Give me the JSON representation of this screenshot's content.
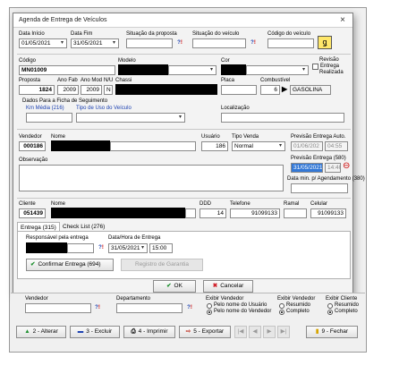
{
  "window": {
    "title": "Agenda de Entrega de Veículos",
    "close": "×"
  },
  "filter": {
    "data_inicio_label": "Data Início",
    "data_inicio": "01/05/2021",
    "data_fim_label": "Data Fim",
    "data_fim": "31/05/2021",
    "situacao_proposta_label": "Situação da proposta",
    "situacao_veiculo_label": "Situação do veículo",
    "codigo_veiculo_label": "Código do veículo",
    "lookup": "?",
    "lookup_mark": "!"
  },
  "vehicle": {
    "codigo_label": "Código",
    "codigo": "MN01009",
    "modelo_label": "Modelo",
    "cor_label": "Cor",
    "revisao_label": "Revisão",
    "entrega_label": "Entrega",
    "realizada_label": "Realizada",
    "proposta_label": "Proposta",
    "proposta": "1824",
    "ano_fab_label": "Ano Fab",
    "ano_fab": "2009",
    "ano_mod_label": "Ano Mod",
    "ano_mod": "2009",
    "nu_label": "N/U",
    "nu": "N",
    "chassi_label": "Chassi",
    "placa_label": "Placa",
    "combustivel_label": "Combustível",
    "combustivel_code": "6",
    "combustivel": "GASOLINA"
  },
  "followup": {
    "group_label": "Dados Para a Ficha de Seguimento",
    "km_label": "Km Média (216)",
    "tipo_uso_label": "Tipo de Uso do Veículo",
    "localizacao_label": "Localização"
  },
  "seller": {
    "vendedor_label": "Vendedor",
    "vendedor": "000186",
    "nome_label": "Nome",
    "usuario_label": "Usuário",
    "usuario": "186",
    "tipo_venda_label": "Tipo Venda",
    "tipo_venda": "Normal",
    "prev_auto_label": "Previsão Entrega Auto.",
    "prev_auto_date": "01/06/202",
    "prev_auto_time": "04:55",
    "obs_label": "Observação",
    "prev_580_label": "Previsão Entrega (580)",
    "prev_580_date": "31/05/2021",
    "prev_580_time": "14:40",
    "data_min_label": "Data min. p/ Agendamento (380)"
  },
  "client": {
    "cliente_label": "Cliente",
    "cliente": "051439",
    "nome_label": "Nome",
    "ddd_label": "DDD",
    "ddd": "14",
    "telefone_label": "Telefone",
    "telefone": "91099133",
    "ramal_label": "Ramal",
    "celular_label": "Celular",
    "celular": "91099133"
  },
  "tabs": [
    "Entrega (315)",
    "Check List (276)"
  ],
  "entrega": {
    "responsavel_label": "Responsável pela entrega",
    "data_hora_label": "Data/Hora de Entrega",
    "data": "31/05/2021",
    "hora": "15:00",
    "confirmar": "Confirmar Entrega (694)",
    "garantia": "Registro de Garantia"
  },
  "dialog_buttons": {
    "ok": "OK",
    "cancel": "Cancelar"
  },
  "background": {
    "vendedor_label": "Vendedor",
    "departamento_label": "Departamento",
    "exibir_vendedor_label": "Exibir Vendedor",
    "pelo_nome_usuario": "Pelo nome do Usuário",
    "pelo_nome_vendedor": "Pelo nome do Vendedor",
    "exibir_vendedor2_label": "Exibir Vendedor",
    "resumido": "Resumido",
    "completo": "Completo",
    "exibir_cliente_label": "Exibir Cliente",
    "resumido2": "Resumido",
    "completo2": "Completo",
    "toolbar": {
      "alterar": "2 - Alterar",
      "excluir": "3 - Excluir",
      "imprimir": "4 - Imprimir",
      "exportar": "5 - Exportar",
      "fechar": "9 - Fechar"
    }
  }
}
